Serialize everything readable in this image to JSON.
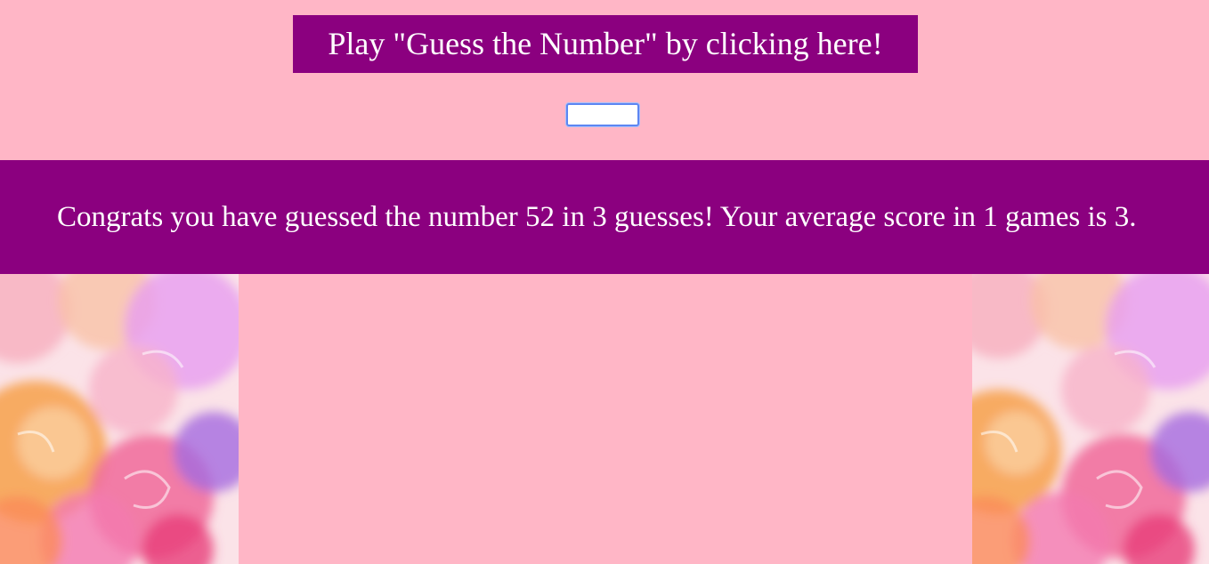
{
  "play_button": {
    "label": "Play \"Guess the Number\" by clicking here!"
  },
  "guess_input": {
    "value": "",
    "placeholder": ""
  },
  "result": {
    "message": "Congrats you have guessed the number 52 in 3 guesses! Your average score in 1 games is 3."
  },
  "colors": {
    "background": "#ffb6c6",
    "accent": "#8b007f",
    "text_on_accent": "#ffffff"
  }
}
